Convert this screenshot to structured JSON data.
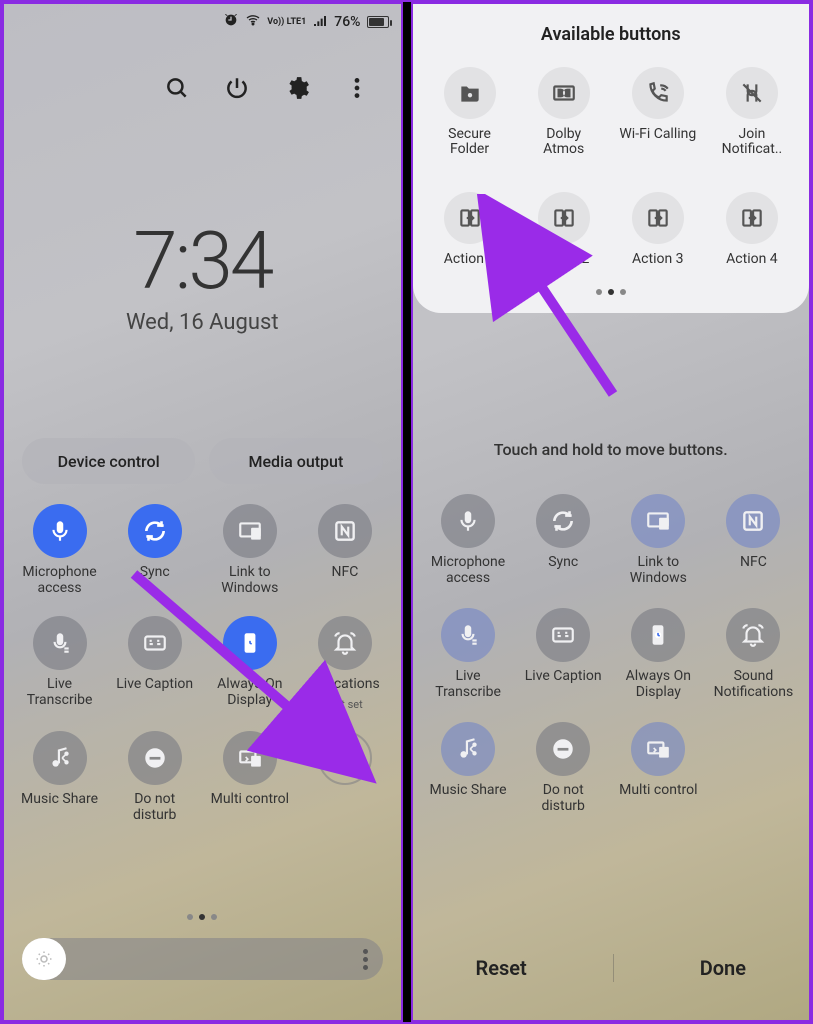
{
  "left": {
    "status": {
      "battery_pct": "76%",
      "net_label": "Vo)) LTE1"
    },
    "clock": {
      "time": "7:34",
      "date": "Wed, 16 August"
    },
    "pills": {
      "device_control": "Device control",
      "media_output": "Media output"
    },
    "tiles": [
      {
        "label": "Microphone\naccess",
        "style": "blue",
        "icon": "mic"
      },
      {
        "label": "Sync",
        "style": "blue",
        "icon": "sync"
      },
      {
        "label": "Link to\nWindows",
        "style": "grey",
        "icon": "link-win"
      },
      {
        "label": "NFC",
        "style": "grey",
        "icon": "nfc"
      },
      {
        "label": "Live\nTranscribe",
        "style": "grey",
        "icon": "transcribe"
      },
      {
        "label": "Live Caption",
        "style": "grey",
        "icon": "caption"
      },
      {
        "label": "Always On\nDisplay",
        "style": "blue",
        "icon": "aod"
      },
      {
        "label": "Sound\nNotifications",
        "sublabel": "Not set",
        "style": "grey",
        "icon": "bell",
        "truncated": "otifications"
      },
      {
        "label": "Music Share",
        "style": "grey",
        "icon": "music-share"
      },
      {
        "label": "Do not\ndisturb",
        "style": "grey",
        "icon": "dnd"
      },
      {
        "label": "Multi control",
        "style": "grey",
        "icon": "multi"
      },
      {
        "label": "",
        "style": "ghost",
        "icon": "plus"
      }
    ]
  },
  "right": {
    "sheet_title": "Available buttons",
    "available": [
      {
        "label": "Secure\nFolder",
        "icon": "secure-folder"
      },
      {
        "label": "Dolby\nAtmos",
        "icon": "dolby"
      },
      {
        "label": "Wi-Fi Calling",
        "icon": "wifi-call"
      },
      {
        "label": "Join Notificat..",
        "icon": "join"
      },
      {
        "label": "Action 1",
        "icon": "action"
      },
      {
        "label": "Action 2",
        "icon": "action"
      },
      {
        "label": "Action 3",
        "icon": "action"
      },
      {
        "label": "Action 4",
        "icon": "action"
      }
    ],
    "hint": "Touch and hold to move buttons.",
    "tiles": [
      {
        "label": "Microphone\naccess",
        "icon": "mic"
      },
      {
        "label": "Sync",
        "icon": "sync"
      },
      {
        "label": "Link to\nWindows",
        "icon": "link-win",
        "blueish": true
      },
      {
        "label": "NFC",
        "icon": "nfc",
        "blueish": true
      },
      {
        "label": "Live\nTranscribe",
        "icon": "transcribe",
        "blueish": true
      },
      {
        "label": "Live Caption",
        "icon": "caption"
      },
      {
        "label": "Always On\nDisplay",
        "icon": "aod"
      },
      {
        "label": "Sound\nNotifications",
        "icon": "bell"
      },
      {
        "label": "Music Share",
        "icon": "music-share",
        "blueish": true
      },
      {
        "label": "Do not\ndisturb",
        "icon": "dnd"
      },
      {
        "label": "Multi control",
        "icon": "multi",
        "blueish": true
      }
    ],
    "buttons": {
      "reset": "Reset",
      "done": "Done"
    }
  }
}
